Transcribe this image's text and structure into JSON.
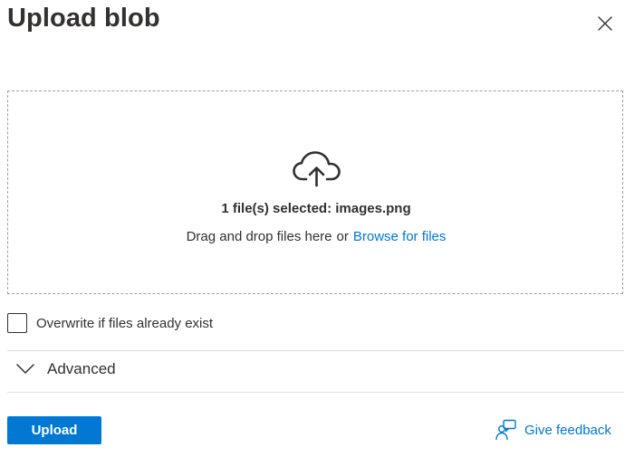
{
  "panel": {
    "title": "Upload blob"
  },
  "icons": {
    "close": "close-icon",
    "upload": "cloud-upload-icon",
    "chevron": "chevron-down-icon",
    "feedback": "feedback-person-icon"
  },
  "dropzone": {
    "selected_text": "1 file(s) selected: images.png",
    "drag_text": "Drag and drop files here",
    "or_text": "or",
    "browse_label": "Browse for files"
  },
  "options": {
    "overwrite_label": "Overwrite if files already exist",
    "overwrite_checked": false,
    "advanced_label": "Advanced",
    "advanced_expanded": false
  },
  "footer": {
    "upload_label": "Upload",
    "feedback_label": "Give feedback"
  },
  "colors": {
    "accent": "#0078d4",
    "text": "#323130",
    "border": "#a19f9d",
    "divider": "#e1dfdd"
  }
}
